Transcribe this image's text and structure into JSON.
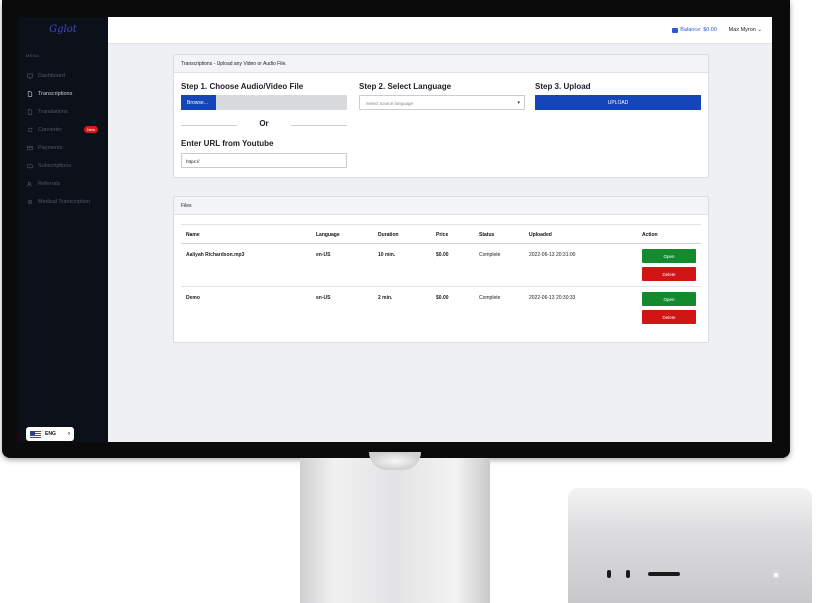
{
  "app": {
    "logo": "Gglot"
  },
  "sidebar": {
    "menu_label": "MENU",
    "items": [
      {
        "label": "Dashboard",
        "icon": "monitor-icon",
        "active": false
      },
      {
        "label": "Transcriptions",
        "icon": "document-icon",
        "active": true
      },
      {
        "label": "Translations",
        "icon": "document-icon",
        "active": false
      },
      {
        "label": "Converter",
        "icon": "refresh-icon",
        "active": false,
        "badge": "New"
      },
      {
        "label": "Payments",
        "icon": "credit-card-icon",
        "active": false
      },
      {
        "label": "Subscriptions",
        "icon": "wallet-icon",
        "active": false
      },
      {
        "label": "Referrals",
        "icon": "users-icon",
        "active": false
      },
      {
        "label": "Medical Transcription",
        "icon": "settings-icon",
        "active": false
      }
    ],
    "language": {
      "label": "ENG",
      "flag": "us-flag-icon"
    }
  },
  "header": {
    "balance": "Balance: $0.00",
    "user": "Max Myron"
  },
  "upload_card": {
    "title": "Transcriptions - Upload any Video or Audio File.",
    "step1_title": "Step 1. Choose Audio/Video File",
    "browse_label": "Browse...",
    "or_label": "Or",
    "url_title": "Enter URL from Youtube",
    "url_value": "https://",
    "step2_title": "Step 2. Select Language",
    "language_placeholder": "Select source language",
    "step3_title": "Step 3. Upload",
    "upload_label": "UPLOAD"
  },
  "files_card": {
    "title": "Files",
    "columns": [
      "Name",
      "Language",
      "Duration",
      "Price",
      "Status",
      "Uploaded",
      "Action"
    ],
    "rows": [
      {
        "name": "Aaliyah Richardson.mp3",
        "language": "en-US",
        "duration": "10 min.",
        "price": "$0.00",
        "status": "Complete",
        "uploaded": "2022-06-13 20:31:00",
        "open": "Open",
        "delete": "Delete"
      },
      {
        "name": "Demo",
        "language": "en-US",
        "duration": "2 min.",
        "price": "$0.00",
        "status": "Complete",
        "uploaded": "2022-06-13 20:30:33",
        "open": "Open",
        "delete": "Delete"
      }
    ]
  },
  "colors": {
    "primary": "#1446b8",
    "success": "#138a2e",
    "danger": "#d11414",
    "sidebar_bg": "#0c1019"
  }
}
